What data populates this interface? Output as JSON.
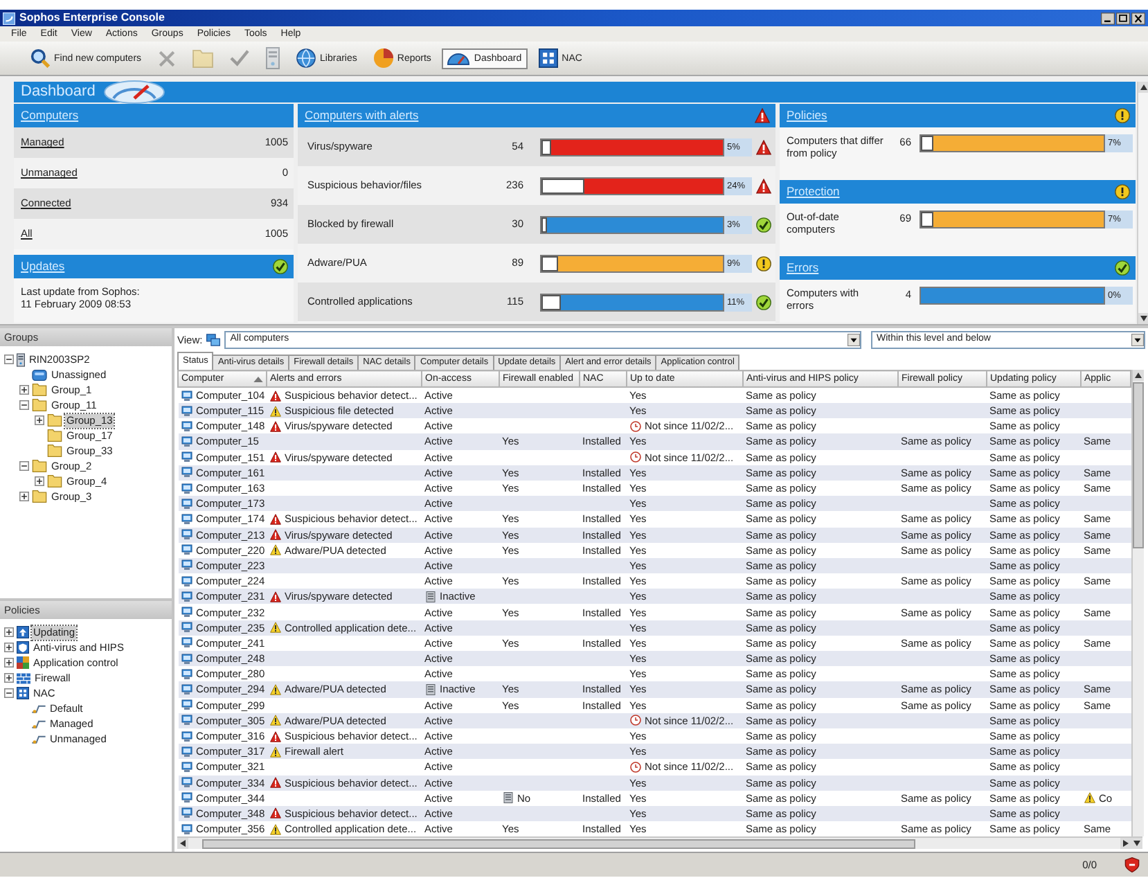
{
  "window": {
    "title": "Sophos Enterprise Console"
  },
  "menu": [
    "File",
    "Edit",
    "View",
    "Actions",
    "Groups",
    "Policies",
    "Tools",
    "Help"
  ],
  "toolbar": [
    {
      "kind": "find",
      "label": "Find new computers",
      "disabled": false,
      "selected": false
    },
    {
      "kind": "delete",
      "disabled": true,
      "selected": false
    },
    {
      "kind": "folder",
      "disabled": true,
      "selected": false
    },
    {
      "kind": "check",
      "disabled": true,
      "selected": false
    },
    {
      "kind": "server",
      "disabled": true,
      "selected": false
    },
    {
      "kind": "libraries",
      "label": "Libraries",
      "disabled": false,
      "selected": false
    },
    {
      "kind": "reports",
      "label": "Reports",
      "disabled": false,
      "selected": false
    },
    {
      "kind": "dashboard",
      "label": "Dashboard",
      "disabled": false,
      "selected": true
    },
    {
      "kind": "nac",
      "label": "NAC",
      "disabled": false,
      "selected": false
    }
  ],
  "dashboard": {
    "title": "Dashboard",
    "computers": {
      "title": "Computers",
      "rows": [
        {
          "label": "Managed",
          "count": "1005"
        },
        {
          "label": "Unmanaged",
          "count": "0"
        },
        {
          "label": "Connected",
          "count": "934"
        },
        {
          "label": "All",
          "count": "1005"
        }
      ]
    },
    "updates": {
      "title": "Updates",
      "kind": "ok",
      "text": "Last update from Sophos:\n11 February 2009   08:53"
    },
    "alerts": {
      "title": "Computers with alerts",
      "kind": "critical",
      "rows": [
        {
          "label": "Virus/spyware",
          "count": "54",
          "level": 0.05,
          "percent": "5%",
          "kind": "critical"
        },
        {
          "label": "Suspicious behavior/files",
          "count": "236",
          "level": 0.24,
          "percent": "24%",
          "kind": "critical"
        },
        {
          "label": "Blocked by firewall",
          "count": "30",
          "level": 0.03,
          "percent": "3%",
          "kind": "ok"
        },
        {
          "label": "Adware/PUA",
          "count": "89",
          "level": 0.09,
          "percent": "9%",
          "kind": "warning"
        },
        {
          "label": "Controlled applications",
          "count": "115",
          "level": 0.11,
          "percent": "11%",
          "kind": "ok"
        }
      ]
    },
    "sections": [
      {
        "title": "Policies",
        "kind": "warning",
        "rows": [
          {
            "label": "Computers that differ from policy",
            "count": "66",
            "level": 0.07,
            "percent": "7%",
            "kind": "warning"
          }
        ]
      },
      {
        "title": "Protection",
        "kind": "warning",
        "rows": [
          {
            "label": "Out-of-date computers",
            "count": "69",
            "level": 0.07,
            "percent": "7%",
            "kind": "warning"
          }
        ]
      },
      {
        "title": "Errors",
        "kind": "ok",
        "rows": [
          {
            "label": "Computers with errors",
            "count": "4",
            "percent": "0%",
            "kind": "ok"
          }
        ]
      }
    ]
  },
  "groups": {
    "title": "Groups",
    "tree": [
      {
        "label": "RIN2003SP2",
        "kind": "server",
        "expanded": true,
        "selected": false,
        "children": [
          {
            "label": "Unassigned",
            "kind": "unassigned",
            "selected": false
          },
          {
            "label": "Group_1",
            "kind": "folder",
            "expanded": false,
            "selected": false
          },
          {
            "label": "Group_11",
            "kind": "folder",
            "expanded": true,
            "selected": false,
            "children": [
              {
                "label": "Group_13",
                "kind": "folder",
                "expanded": false,
                "selected": true
              },
              {
                "label": "Group_17",
                "kind": "folder",
                "selected": false
              },
              {
                "label": "Group_33",
                "kind": "folder",
                "selected": false
              }
            ]
          },
          {
            "label": "Group_2",
            "kind": "folder",
            "expanded": true,
            "selected": false,
            "children": [
              {
                "label": "Group_4",
                "kind": "folder",
                "expanded": false,
                "selected": false
              }
            ]
          },
          {
            "label": "Group_3",
            "kind": "folder",
            "expanded": false,
            "selected": false
          }
        ]
      }
    ]
  },
  "policies": {
    "title": "Policies",
    "tree": [
      {
        "label": "Updating",
        "kind": "updating",
        "expanded": false,
        "selected": true
      },
      {
        "label": "Anti-virus and HIPS",
        "kind": "antivirus",
        "expanded": false,
        "selected": false
      },
      {
        "label": "Application control",
        "kind": "appcontrol",
        "expanded": false,
        "selected": false
      },
      {
        "label": "Firewall",
        "kind": "firewall",
        "expanded": false,
        "selected": false
      },
      {
        "label": "NAC",
        "kind": "nac",
        "expanded": true,
        "selected": false,
        "children": [
          {
            "label": "Default",
            "kind": "nac-policy",
            "selected": false
          },
          {
            "label": "Managed",
            "kind": "nac-policy",
            "selected": false
          },
          {
            "label": "Unmanaged",
            "kind": "nac-policy",
            "selected": false
          }
        ]
      }
    ]
  },
  "view": {
    "label": "View:",
    "value": "All computers",
    "scope": "Within this level and below"
  },
  "tabs": [
    {
      "label": "Status",
      "selected": true
    },
    {
      "label": "Anti-virus details",
      "selected": false
    },
    {
      "label": "Firewall details",
      "selected": false
    },
    {
      "label": "NAC details",
      "selected": false
    },
    {
      "label": "Computer details",
      "selected": false
    },
    {
      "label": "Update details",
      "selected": false
    },
    {
      "label": "Alert and error details",
      "selected": false
    },
    {
      "label": "Application control",
      "selected": false
    }
  ],
  "table": {
    "columns": [
      {
        "label": "Computer",
        "sorted": true
      },
      {
        "label": "Alerts and errors"
      },
      {
        "label": "On-access"
      },
      {
        "label": "Firewall enabled"
      },
      {
        "label": "NAC"
      },
      {
        "label": "Up to date"
      },
      {
        "label": "Anti-virus and HIPS policy"
      },
      {
        "label": "Firewall policy"
      },
      {
        "label": "Updating policy"
      },
      {
        "label": "Applic"
      }
    ],
    "rows": [
      {
        "name": "Computer_104",
        "alert": {
          "kind": "critical",
          "text": "Suspicious behavior detect..."
        },
        "on_access": {
          "text": "Active",
          "flagged": false
        },
        "up_to_date": {
          "text": "Yes",
          "flagged": false
        },
        "av_policy": "Same as policy",
        "updating_policy": "Same as policy"
      },
      {
        "name": "Computer_115",
        "alert": {
          "kind": "warning",
          "text": "Suspicious file detected"
        },
        "on_access": {
          "text": "Active",
          "flagged": false
        },
        "up_to_date": {
          "text": "Yes",
          "flagged": false
        },
        "av_policy": "Same as policy",
        "updating_policy": "Same as policy"
      },
      {
        "name": "Computer_148",
        "alert": {
          "kind": "critical",
          "text": "Virus/spyware detected"
        },
        "on_access": {
          "text": "Active",
          "flagged": false
        },
        "up_to_date": {
          "text": "Not since 11/02/2...",
          "flagged": true
        },
        "av_policy": "Same as policy",
        "updating_policy": "Same as policy"
      },
      {
        "name": "Computer_15",
        "on_access": {
          "text": "Active",
          "flagged": false
        },
        "firewall_enabled": {
          "text": "Yes",
          "flagged": false
        },
        "nac": "Installed",
        "up_to_date": {
          "text": "Yes",
          "flagged": false
        },
        "av_policy": "Same as policy",
        "firewall_policy": "Same as policy",
        "updating_policy": "Same as policy",
        "app_policy": {
          "text": "Same",
          "flagged": false
        }
      },
      {
        "name": "Computer_151",
        "alert": {
          "kind": "critical",
          "text": "Virus/spyware detected"
        },
        "on_access": {
          "text": "Active",
          "flagged": false
        },
        "up_to_date": {
          "text": "Not since 11/02/2...",
          "flagged": true
        },
        "av_policy": "Same as policy",
        "updating_policy": "Same as policy"
      },
      {
        "name": "Computer_161",
        "on_access": {
          "text": "Active",
          "flagged": false
        },
        "firewall_enabled": {
          "text": "Yes",
          "flagged": false
        },
        "nac": "Installed",
        "up_to_date": {
          "text": "Yes",
          "flagged": false
        },
        "av_policy": "Same as policy",
        "firewall_policy": "Same as policy",
        "updating_policy": "Same as policy",
        "app_policy": {
          "text": "Same",
          "flagged": false
        }
      },
      {
        "name": "Computer_163",
        "on_access": {
          "text": "Active",
          "flagged": false
        },
        "firewall_enabled": {
          "text": "Yes",
          "flagged": false
        },
        "nac": "Installed",
        "up_to_date": {
          "text": "Yes",
          "flagged": false
        },
        "av_policy": "Same as policy",
        "firewall_policy": "Same as policy",
        "updating_policy": "Same as policy",
        "app_policy": {
          "text": "Same",
          "flagged": false
        }
      },
      {
        "name": "Computer_173",
        "on_access": {
          "text": "Active",
          "flagged": false
        },
        "up_to_date": {
          "text": "Yes",
          "flagged": false
        },
        "av_policy": "Same as policy",
        "updating_policy": "Same as policy"
      },
      {
        "name": "Computer_174",
        "alert": {
          "kind": "critical",
          "text": "Suspicious behavior detect..."
        },
        "on_access": {
          "text": "Active",
          "flagged": false
        },
        "firewall_enabled": {
          "text": "Yes",
          "flagged": false
        },
        "nac": "Installed",
        "up_to_date": {
          "text": "Yes",
          "flagged": false
        },
        "av_policy": "Same as policy",
        "firewall_policy": "Same as policy",
        "updating_policy": "Same as policy",
        "app_policy": {
          "text": "Same",
          "flagged": false
        }
      },
      {
        "name": "Computer_213",
        "alert": {
          "kind": "critical",
          "text": "Virus/spyware detected"
        },
        "on_access": {
          "text": "Active",
          "flagged": false
        },
        "firewall_enabled": {
          "text": "Yes",
          "flagged": false
        },
        "nac": "Installed",
        "up_to_date": {
          "text": "Yes",
          "flagged": false
        },
        "av_policy": "Same as policy",
        "firewall_policy": "Same as policy",
        "updating_policy": "Same as policy",
        "app_policy": {
          "text": "Same",
          "flagged": false
        }
      },
      {
        "name": "Computer_220",
        "alert": {
          "kind": "warning",
          "text": "Adware/PUA detected"
        },
        "on_access": {
          "text": "Active",
          "flagged": false
        },
        "firewall_enabled": {
          "text": "Yes",
          "flagged": false
        },
        "nac": "Installed",
        "up_to_date": {
          "text": "Yes",
          "flagged": false
        },
        "av_policy": "Same as policy",
        "firewall_policy": "Same as policy",
        "updating_policy": "Same as policy",
        "app_policy": {
          "text": "Same",
          "flagged": false
        }
      },
      {
        "name": "Computer_223",
        "on_access": {
          "text": "Active",
          "flagged": false
        },
        "up_to_date": {
          "text": "Yes",
          "flagged": false
        },
        "av_policy": "Same as policy",
        "updating_policy": "Same as policy"
      },
      {
        "name": "Computer_224",
        "on_access": {
          "text": "Active",
          "flagged": false
        },
        "firewall_enabled": {
          "text": "Yes",
          "flagged": false
        },
        "nac": "Installed",
        "up_to_date": {
          "text": "Yes",
          "flagged": false
        },
        "av_policy": "Same as policy",
        "firewall_policy": "Same as policy",
        "updating_policy": "Same as policy",
        "app_policy": {
          "text": "Same",
          "flagged": false
        }
      },
      {
        "name": "Computer_231",
        "alert": {
          "kind": "critical",
          "text": "Virus/spyware detected"
        },
        "on_access": {
          "text": "Inactive",
          "flagged": true
        },
        "up_to_date": {
          "text": "Yes",
          "flagged": false
        },
        "av_policy": "Same as policy",
        "updating_policy": "Same as policy"
      },
      {
        "name": "Computer_232",
        "on_access": {
          "text": "Active",
          "flagged": false
        },
        "firewall_enabled": {
          "text": "Yes",
          "flagged": false
        },
        "nac": "Installed",
        "up_to_date": {
          "text": "Yes",
          "flagged": false
        },
        "av_policy": "Same as policy",
        "firewall_policy": "Same as policy",
        "updating_policy": "Same as policy",
        "app_policy": {
          "text": "Same",
          "flagged": false
        }
      },
      {
        "name": "Computer_235",
        "alert": {
          "kind": "warning",
          "text": "Controlled application dete..."
        },
        "on_access": {
          "text": "Active",
          "flagged": false
        },
        "up_to_date": {
          "text": "Yes",
          "flagged": false
        },
        "av_policy": "Same as policy",
        "updating_policy": "Same as policy"
      },
      {
        "name": "Computer_241",
        "on_access": {
          "text": "Active",
          "flagged": false
        },
        "firewall_enabled": {
          "text": "Yes",
          "flagged": false
        },
        "nac": "Installed",
        "up_to_date": {
          "text": "Yes",
          "flagged": false
        },
        "av_policy": "Same as policy",
        "firewall_policy": "Same as policy",
        "updating_policy": "Same as policy",
        "app_policy": {
          "text": "Same",
          "flagged": false
        }
      },
      {
        "name": "Computer_248",
        "on_access": {
          "text": "Active",
          "flagged": false
        },
        "up_to_date": {
          "text": "Yes",
          "flagged": false
        },
        "av_policy": "Same as policy",
        "updating_policy": "Same as policy"
      },
      {
        "name": "Computer_280",
        "on_access": {
          "text": "Active",
          "flagged": false
        },
        "up_to_date": {
          "text": "Yes",
          "flagged": false
        },
        "av_policy": "Same as policy",
        "updating_policy": "Same as policy"
      },
      {
        "name": "Computer_294",
        "alert": {
          "kind": "warning",
          "text": "Adware/PUA detected"
        },
        "on_access": {
          "text": "Inactive",
          "flagged": true
        },
        "firewall_enabled": {
          "text": "Yes",
          "flagged": false
        },
        "nac": "Installed",
        "up_to_date": {
          "text": "Yes",
          "flagged": false
        },
        "av_policy": "Same as policy",
        "firewall_policy": "Same as policy",
        "updating_policy": "Same as policy",
        "app_policy": {
          "text": "Same",
          "flagged": false
        }
      },
      {
        "name": "Computer_299",
        "on_access": {
          "text": "Active",
          "flagged": false
        },
        "firewall_enabled": {
          "text": "Yes",
          "flagged": false
        },
        "nac": "Installed",
        "up_to_date": {
          "text": "Yes",
          "flagged": false
        },
        "av_policy": "Same as policy",
        "firewall_policy": "Same as policy",
        "updating_policy": "Same as policy",
        "app_policy": {
          "text": "Same",
          "flagged": false
        }
      },
      {
        "name": "Computer_305",
        "alert": {
          "kind": "warning",
          "text": "Adware/PUA detected"
        },
        "on_access": {
          "text": "Active",
          "flagged": false
        },
        "up_to_date": {
          "text": "Not since 11/02/2...",
          "flagged": true
        },
        "av_policy": "Same as policy",
        "updating_policy": "Same as policy"
      },
      {
        "name": "Computer_316",
        "alert": {
          "kind": "critical",
          "text": "Suspicious behavior detect..."
        },
        "on_access": {
          "text": "Active",
          "flagged": false
        },
        "up_to_date": {
          "text": "Yes",
          "flagged": false
        },
        "av_policy": "Same as policy",
        "updating_policy": "Same as policy"
      },
      {
        "name": "Computer_317",
        "alert": {
          "kind": "warning",
          "text": "Firewall alert"
        },
        "on_access": {
          "text": "Active",
          "flagged": false
        },
        "up_to_date": {
          "text": "Yes",
          "flagged": false
        },
        "av_policy": "Same as policy",
        "updating_policy": "Same as policy"
      },
      {
        "name": "Computer_321",
        "on_access": {
          "text": "Active",
          "flagged": false
        },
        "up_to_date": {
          "text": "Not since 11/02/2...",
          "flagged": true
        },
        "av_policy": "Same as policy",
        "updating_policy": "Same as policy"
      },
      {
        "name": "Computer_334",
        "alert": {
          "kind": "critical",
          "text": "Suspicious behavior detect..."
        },
        "on_access": {
          "text": "Active",
          "flagged": false
        },
        "up_to_date": {
          "text": "Yes",
          "flagged": false
        },
        "av_policy": "Same as policy",
        "updating_policy": "Same as policy"
      },
      {
        "name": "Computer_344",
        "on_access": {
          "text": "Active",
          "flagged": false
        },
        "firewall_enabled": {
          "text": "No",
          "flagged": true
        },
        "nac": "Installed",
        "up_to_date": {
          "text": "Yes",
          "flagged": false
        },
        "av_policy": "Same as policy",
        "firewall_policy": "Same as policy",
        "updating_policy": "Same as policy",
        "app_policy": {
          "text": "Co",
          "flagged": true
        }
      },
      {
        "name": "Computer_348",
        "alert": {
          "kind": "critical",
          "text": "Suspicious behavior detect..."
        },
        "on_access": {
          "text": "Active",
          "flagged": false
        },
        "up_to_date": {
          "text": "Yes",
          "flagged": false
        },
        "av_policy": "Same as policy",
        "updating_policy": "Same as policy"
      },
      {
        "name": "Computer_356",
        "alert": {
          "kind": "warning",
          "text": "Controlled application dete..."
        },
        "on_access": {
          "text": "Active",
          "flagged": false
        },
        "firewall_enabled": {
          "text": "Yes",
          "flagged": false
        },
        "nac": "Installed",
        "up_to_date": {
          "text": "Yes",
          "flagged": false
        },
        "av_policy": "Same as policy",
        "firewall_policy": "Same as policy",
        "updating_policy": "Same as policy",
        "app_policy": {
          "text": "Same",
          "flagged": false
        }
      }
    ]
  },
  "status_bar": {
    "text": "0/0"
  }
}
